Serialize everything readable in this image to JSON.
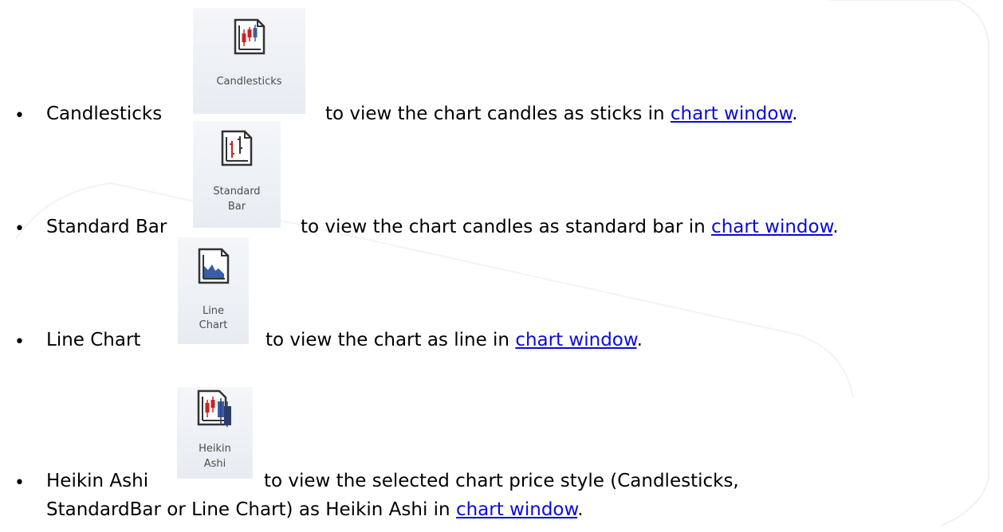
{
  "items": [
    {
      "label": "Candlesticks",
      "icon": "candlesticks-icon",
      "button_label_lines": [
        "Candlesticks"
      ],
      "description": "to view the chart candles as sticks in ",
      "link": "chart window",
      "suffix": "."
    },
    {
      "label": "Standard Bar",
      "icon": "standard-bar-icon",
      "button_label_lines": [
        "Standard",
        "Bar"
      ],
      "description": "to view the chart candles as standard bar in ",
      "link": "chart window",
      "suffix": "."
    },
    {
      "label": "Line Chart",
      "icon": "line-chart-icon",
      "button_label_lines": [
        "Line",
        "Chart"
      ],
      "description": "to view the chart as line in ",
      "link": "chart window",
      "suffix": "."
    },
    {
      "label": "Heikin Ashi",
      "icon": "heikin-ashi-icon",
      "button_label_lines": [
        "Heikin",
        "Ashi"
      ],
      "description": "to view the selected chart price style (Candlesticks,",
      "description_line2": "StandardBar or Line Chart) as Heikin Ashi in ",
      "link": "chart window",
      "suffix": "."
    }
  ],
  "bullet_char": "•",
  "colors": {
    "link": "#0b0bd9",
    "text": "#000000",
    "button_label": "#4d4d4d",
    "icon_red": "#cc2222",
    "icon_blue": "#3a5fa8"
  }
}
